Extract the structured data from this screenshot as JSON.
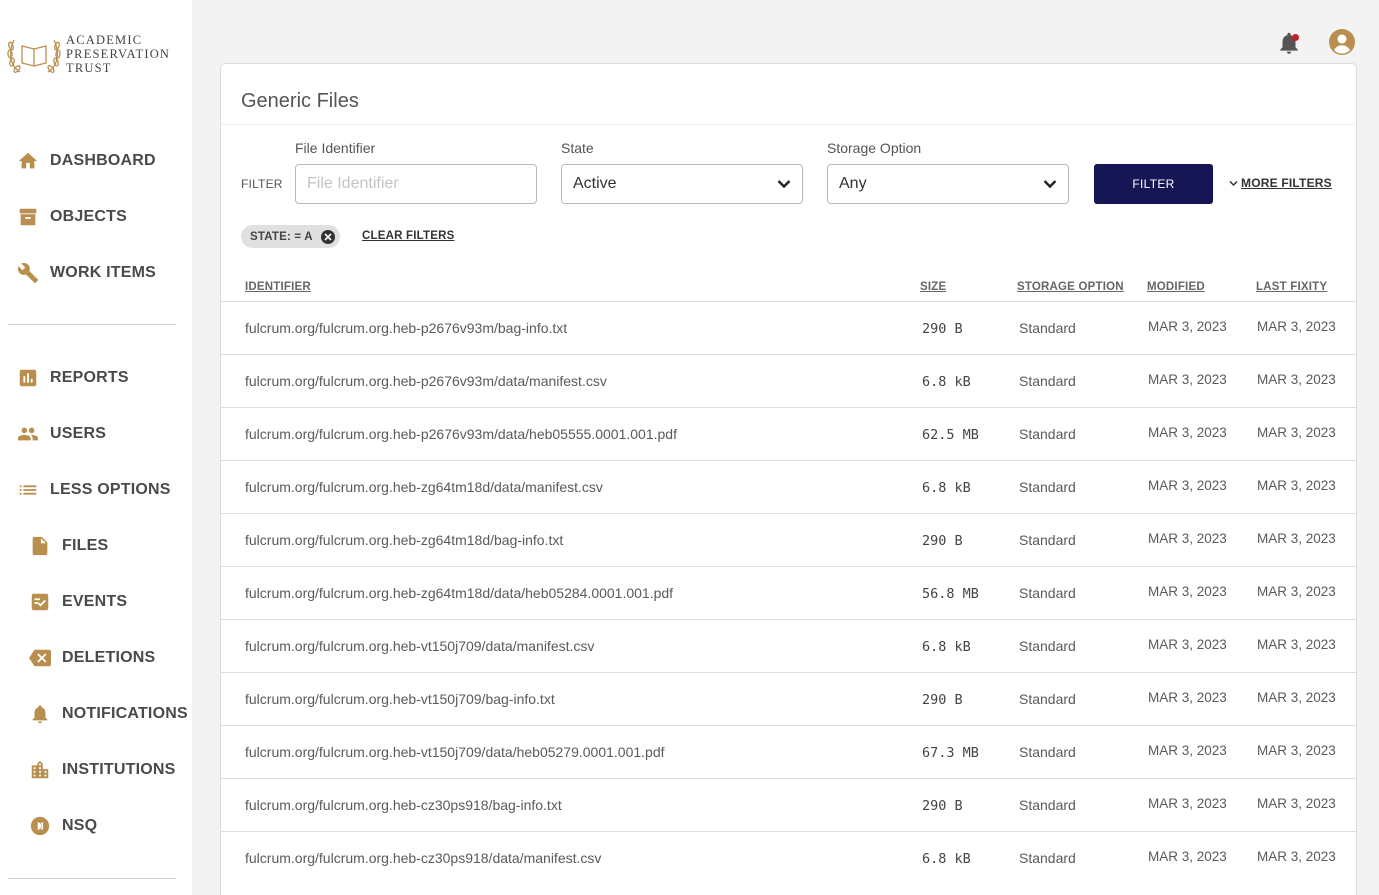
{
  "brand": {
    "line1": "ACADEMIC",
    "line2": "PRESERVATION",
    "line3": "TRUST"
  },
  "nav": {
    "dashboard": "DASHBOARD",
    "objects": "OBJECTS",
    "work_items": "WORK ITEMS",
    "reports": "REPORTS",
    "users": "USERS",
    "less_options": "LESS OPTIONS",
    "files": "FILES",
    "events": "EVENTS",
    "deletions": "DELETIONS",
    "notifications": "NOTIFICATIONS",
    "institutions": "INSTITUTIONS",
    "nsq": "NSQ"
  },
  "colors": {
    "accent": "#b98f4f",
    "primary_button": "#161655",
    "notification_dot": "#c0202a"
  },
  "page": {
    "title": "Generic Files"
  },
  "filters": {
    "filter_label": "FILTER",
    "file_identifier": {
      "label": "File Identifier",
      "placeholder": "File Identifier",
      "value": ""
    },
    "state": {
      "label": "State",
      "value": "Active"
    },
    "storage_option": {
      "label": "Storage Option",
      "value": "Any"
    },
    "filter_button": "FILTER",
    "more_filters": "MORE FILTERS",
    "active_chip": "STATE: = A",
    "clear_filters": "CLEAR FILTERS"
  },
  "table": {
    "headers": {
      "identifier": "IDENTIFIER",
      "size": "SIZE",
      "storage_option": "STORAGE OPTION",
      "modified": "MODIFIED",
      "last_fixity": "LAST FIXITY"
    },
    "rows": [
      {
        "identifier": "fulcrum.org/fulcrum.org.heb-p2676v93m/bag-info.txt",
        "size": "290 B",
        "storage": "Standard",
        "modified": "MAR 3, 2023",
        "fixity": "MAR 3, 2023"
      },
      {
        "identifier": "fulcrum.org/fulcrum.org.heb-p2676v93m/data/manifest.csv",
        "size": "6.8 kB",
        "storage": "Standard",
        "modified": "MAR 3, 2023",
        "fixity": "MAR 3, 2023"
      },
      {
        "identifier": "fulcrum.org/fulcrum.org.heb-p2676v93m/data/heb05555.0001.001.pdf",
        "size": "62.5 MB",
        "storage": "Standard",
        "modified": "MAR 3, 2023",
        "fixity": "MAR 3, 2023"
      },
      {
        "identifier": "fulcrum.org/fulcrum.org.heb-zg64tm18d/data/manifest.csv",
        "size": "6.8 kB",
        "storage": "Standard",
        "modified": "MAR 3, 2023",
        "fixity": "MAR 3, 2023"
      },
      {
        "identifier": "fulcrum.org/fulcrum.org.heb-zg64tm18d/bag-info.txt",
        "size": "290 B",
        "storage": "Standard",
        "modified": "MAR 3, 2023",
        "fixity": "MAR 3, 2023"
      },
      {
        "identifier": "fulcrum.org/fulcrum.org.heb-zg64tm18d/data/heb05284.0001.001.pdf",
        "size": "56.8 MB",
        "storage": "Standard",
        "modified": "MAR 3, 2023",
        "fixity": "MAR 3, 2023"
      },
      {
        "identifier": "fulcrum.org/fulcrum.org.heb-vt150j709/data/manifest.csv",
        "size": "6.8 kB",
        "storage": "Standard",
        "modified": "MAR 3, 2023",
        "fixity": "MAR 3, 2023"
      },
      {
        "identifier": "fulcrum.org/fulcrum.org.heb-vt150j709/bag-info.txt",
        "size": "290 B",
        "storage": "Standard",
        "modified": "MAR 3, 2023",
        "fixity": "MAR 3, 2023"
      },
      {
        "identifier": "fulcrum.org/fulcrum.org.heb-vt150j709/data/heb05279.0001.001.pdf",
        "size": "67.3 MB",
        "storage": "Standard",
        "modified": "MAR 3, 2023",
        "fixity": "MAR 3, 2023"
      },
      {
        "identifier": "fulcrum.org/fulcrum.org.heb-cz30ps918/bag-info.txt",
        "size": "290 B",
        "storage": "Standard",
        "modified": "MAR 3, 2023",
        "fixity": "MAR 3, 2023"
      },
      {
        "identifier": "fulcrum.org/fulcrum.org.heb-cz30ps918/data/manifest.csv",
        "size": "6.8 kB",
        "storage": "Standard",
        "modified": "MAR 3, 2023",
        "fixity": "MAR 3, 2023"
      }
    ]
  }
}
